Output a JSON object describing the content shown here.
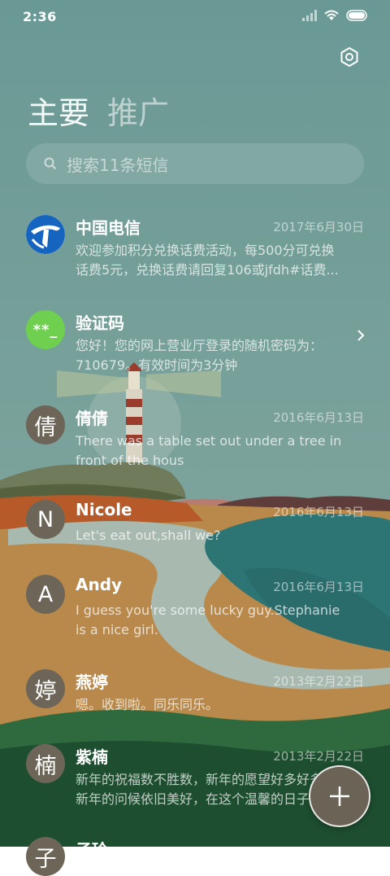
{
  "status_bar": {
    "time": "2:36"
  },
  "tabs": {
    "primary": "主要",
    "promotions": "推广"
  },
  "search": {
    "placeholder": "搜索11条短信"
  },
  "icons": {
    "settings": "gear-icon",
    "search": "search-icon",
    "compose": "plus-icon",
    "chevron": "chevron-right-icon"
  },
  "colors": {
    "sky": "#6b9a96",
    "avatar_gray": "#6d6658",
    "code_green": "#6fcf4f",
    "telecom_blue": "#1565c0",
    "fab": "#6b6456"
  },
  "conversations": [
    {
      "avatar": "",
      "name": "中国电信",
      "date": "2017年6月30日",
      "line1": "欢迎参加积分兑换话费活动，每500分可兑换",
      "line2": "话费5元，兑换话费请回复106或jfdh#话费..."
    },
    {
      "avatar": "**_",
      "name": "验证码",
      "date": "",
      "line1": "您好！您的网上营业厅登录的随机密码为：",
      "line2": "710679。有效时间为3分钟"
    },
    {
      "avatar": "倩",
      "name": "倩倩",
      "date": "2016年6月13日",
      "line1": "There was a table set out under a tree in",
      "line2": "front of the hous"
    },
    {
      "avatar": "N",
      "name": "Nicole",
      "date": "2016年6月13日",
      "line1": "Let's eat out,shall we?",
      "line2": ""
    },
    {
      "avatar": "A",
      "name": "Andy",
      "date": "2016年6月13日",
      "line1": "I guess you're some lucky guy.Stephanie",
      "line2": "is a nice girl."
    },
    {
      "avatar": "婷",
      "name": "燕婷",
      "date": "2013年2月22日",
      "line1": "嗯。收到啦。同乐同乐。",
      "line2": ""
    },
    {
      "avatar": "楠",
      "name": "紫楠",
      "date": "2013年2月22日",
      "line1": "新年的祝福数不胜数，新年的愿望好多好多，",
      "line2": "新年的问候依旧美好，在这个温馨的日子里"
    },
    {
      "avatar": "子",
      "name": "子玲",
      "date": "",
      "line1": "",
      "line2": ""
    }
  ]
}
